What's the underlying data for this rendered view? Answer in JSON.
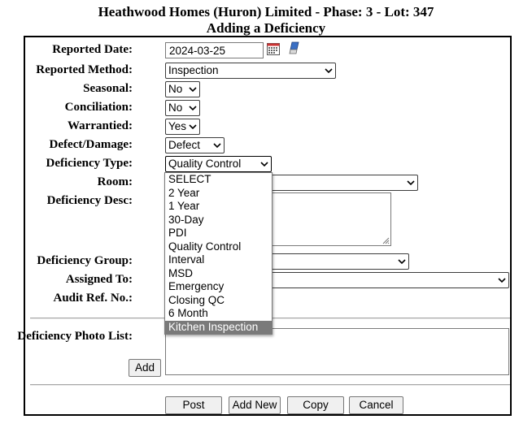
{
  "header": {
    "title": "Heathwood Homes (Huron) Limited - Phase: 3 - Lot: 347",
    "subtitle": "Adding a Deficiency"
  },
  "form": {
    "reported_date": {
      "label": "Reported Date:",
      "value": "2024-03-25",
      "calendar_icon": "calendar-icon",
      "clear_icon": "eraser-icon"
    },
    "reported_method": {
      "label": "Reported Method:",
      "value": "Inspection"
    },
    "seasonal": {
      "label": "Seasonal:",
      "value": "No"
    },
    "conciliation": {
      "label": "Conciliation:",
      "value": "No"
    },
    "warrantied": {
      "label": "Warrantied:",
      "value": "Yes"
    },
    "defect_damage": {
      "label": "Defect/Damage:",
      "value": "Defect"
    },
    "deficiency_type": {
      "label": "Deficiency Type:",
      "value": "Quality Control",
      "options": [
        "SELECT",
        "2 Year",
        "1 Year",
        "30-Day",
        "PDI",
        "Quality Control",
        "Interval",
        "MSD",
        "Emergency",
        "Closing QC",
        "6 Month",
        "Kitchen Inspection"
      ],
      "highlighted": "Kitchen Inspection"
    },
    "room": {
      "label": "Room:",
      "value": ""
    },
    "deficiency_desc": {
      "label": "Deficiency Desc:",
      "value": ""
    },
    "deficiency_group": {
      "label": "Deficiency Group:",
      "value": ""
    },
    "assigned_to": {
      "label": "Assigned To:",
      "value": ""
    },
    "audit_ref": {
      "label": "Audit Ref. No.:",
      "value": ""
    },
    "photo_list": {
      "label": "Deficiency Photo List:",
      "add_label": "Add"
    }
  },
  "actions": {
    "post": "Post",
    "add_new": "Add New",
    "copy": "Copy",
    "cancel": "Cancel"
  },
  "colors": {
    "highlight_bg": "#7a7a7a",
    "button_bg": "#f0f0f0",
    "frame": "#000000"
  }
}
